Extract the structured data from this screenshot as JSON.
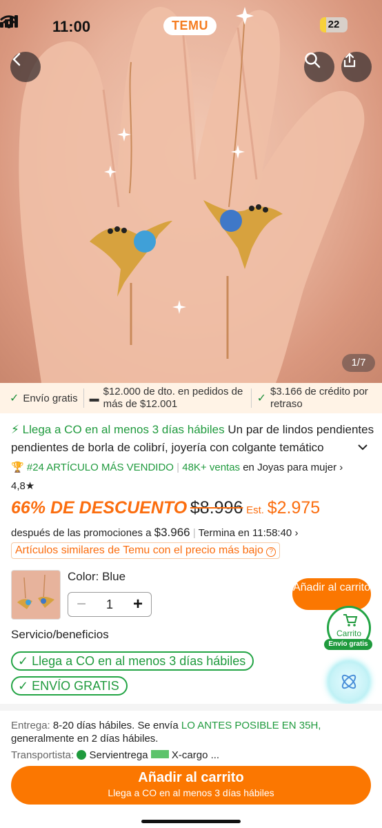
{
  "status_bar": {
    "time": "11:00",
    "app_pill": "TEMU",
    "battery": "22"
  },
  "gallery": {
    "counter": "1/7"
  },
  "banner": {
    "item1": "Envío gratis",
    "item2": "$12.000 de dto. en pedidos de más de $12.001",
    "item3": "$3.166 de crédito por retraso"
  },
  "product": {
    "delivery_fast": "Llega a CO en al menos 3 días hábiles",
    "title": "Un par de lindos pendientes de borla de colibrí, joyería con colgante temático",
    "rank": "#24 ARTÍCULO MÁS VENDIDO",
    "sales": "48K+ ventas",
    "category": "en Joyas para mujer",
    "rating": "4,8",
    "discount": "66% DE DESCUENTO",
    "original_price": "$8.996",
    "est_label": "Est.",
    "est_price": "$2.975",
    "after_promo_label": "después de las promociones a",
    "after_promo_price": "$3.966",
    "ends_label": "Termina en",
    "ends_time": "11:58:40",
    "similar": "Artículos similares de Temu con el precio más bajo",
    "color_label": "Color: Blue",
    "quantity": "1"
  },
  "cart": {
    "add_label": "Añadir al carrito",
    "cart_label": "Carrito",
    "cart_badge": "Envío gratis"
  },
  "service": {
    "title": "Servicio/beneficios",
    "badge1": "Llega a CO en al menos 3 días hábiles",
    "badge2": "ENVÍO GRATIS"
  },
  "shipping": {
    "label": "Entrega:",
    "text1": "8-20 días hábiles. Se envía",
    "highlight": "LO ANTES POSIBLE EN 35H,",
    "text2": "generalmente en 2 días hábiles.",
    "carrier_label": "Transportista:",
    "carrier1": "Servientrega",
    "carrier2": "X-cargo ..."
  },
  "bottom": {
    "add_label": "Añadir al carrito",
    "sub_label": "Llega a CO en al menos 3 días hábiles"
  },
  "colors": {
    "accent": "#fb7701",
    "green": "#1f9a3d"
  }
}
